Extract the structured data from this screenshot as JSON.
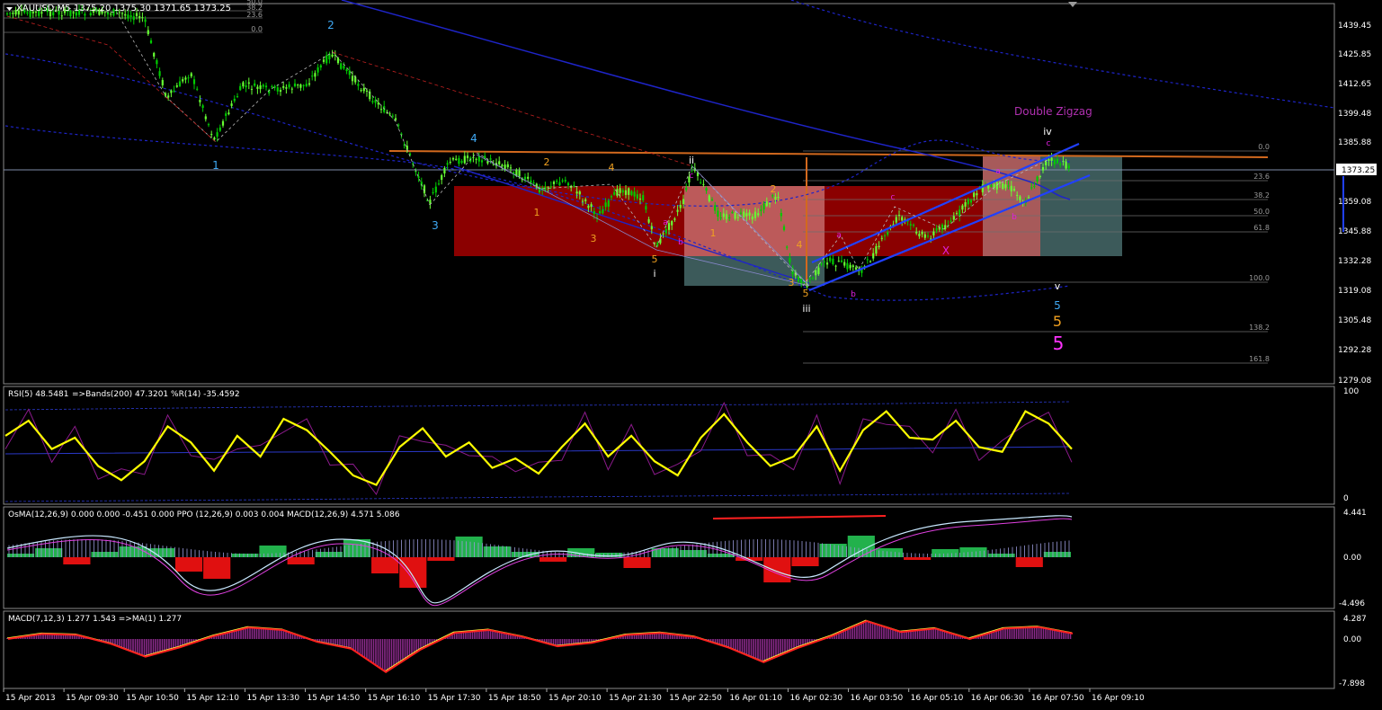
{
  "colors": {
    "background": "#000000",
    "bull_candle": "#66FF33",
    "bear_candle": "#00CC00",
    "ma_blue": "#1E24C8",
    "rsi_line": "#FFFF00",
    "rsi_wpr": "#8B1A8B",
    "osma_pos": "#22B14C",
    "osma_neg": "#E01010",
    "macd_hist": "#8B2A8B",
    "macd_line": "#FF2020",
    "price_line": "#7E8CA8",
    "orange_line": "#D2691E",
    "fib_text": "#9A9A9A",
    "axis_text": "#FFFFFF"
  },
  "header": {
    "symbol": "XAUUSD,M5",
    "ohlc": "1375.20 1375.30 1371.65 1373.25"
  },
  "price_axis": {
    "ticks": [
      "1439.45",
      "1425.85",
      "1412.65",
      "1399.48",
      "1385.88",
      "1373.25",
      "1359.08",
      "1345.88",
      "1332.28",
      "1319.08",
      "1305.48",
      "1292.28",
      "1279.08"
    ],
    "current": "1373.25"
  },
  "fib_top": [
    "50.0",
    "38.2",
    "23.6",
    "0.0"
  ],
  "fib_right": [
    "0.0",
    "23.6",
    "38.2",
    "50.0",
    "61.8",
    "100.0",
    "138.2",
    "161.8"
  ],
  "wave_labels": {
    "cyan": [
      "1",
      "2",
      "3",
      "4",
      "5"
    ],
    "orange": [
      "1",
      "2",
      "3",
      "4",
      "5",
      "1",
      "2",
      "3",
      "4",
      "5",
      "5"
    ],
    "roman": [
      "i",
      "ii",
      "iii",
      "iv",
      "v"
    ],
    "magenta": [
      "a",
      "b",
      "c",
      "a",
      "b",
      "c",
      "a",
      "b",
      "c",
      "X",
      "5"
    ],
    "pattern": "Double Zigzag"
  },
  "rsi_panel": {
    "title": "RSI(5) 48.5481",
    "extra": "=>Bands(200) 47.3201  %R(14) -35.4592",
    "ticks": [
      "100",
      "0"
    ]
  },
  "osma_panel": {
    "title": "OsMA(12,26,9) 0.000 0.000 -0.451 0.000  PPO (12,26,9) 0.003 0.004  MACD(12,26,9) 4.571 5.086",
    "ticks": [
      "4.441",
      "0.00",
      "-4.496"
    ]
  },
  "macd_panel": {
    "title": "MACD(7,12,3) 1.277 1.543  =>MA(1) 1.277",
    "ticks": [
      "4.287",
      "0.00",
      "-7.898"
    ]
  },
  "time_axis": [
    "15 Apr 2013",
    "15 Apr 09:30",
    "15 Apr 10:50",
    "15 Apr 12:10",
    "15 Apr 13:30",
    "15 Apr 14:50",
    "15 Apr 16:10",
    "15 Apr 17:30",
    "15 Apr 18:50",
    "15 Apr 20:10",
    "15 Apr 21:30",
    "15 Apr 22:50",
    "16 Apr 01:10",
    "16 Apr 02:30",
    "16 Apr 03:50",
    "16 Apr 05:10",
    "16 Apr 06:30",
    "16 Apr 07:50",
    "16 Apr 09:10"
  ],
  "chart_data": [
    {
      "type": "candlestick",
      "title": "XAUUSD,M5",
      "ylim": [
        1279.08,
        1445
      ],
      "key_points": [
        {
          "x": "15 Apr 09:10",
          "y": 1443
        },
        {
          "x": "15 Apr 12:10",
          "y": 1386
        },
        {
          "x": "15 Apr 14:50",
          "y": 1427
        },
        {
          "x": "15 Apr 17:30",
          "y": 1353
        },
        {
          "x": "15 Apr 18:50",
          "y": 1377
        },
        {
          "x": "15 Apr 22:50",
          "y": 1338
        },
        {
          "x": "16 Apr 01:10",
          "y": 1367
        },
        {
          "x": "16 Apr 02:30",
          "y": 1321
        },
        {
          "x": "16 Apr 05:10",
          "y": 1356
        },
        {
          "x": "16 Apr 07:50",
          "y": 1366
        },
        {
          "x": "16 Apr 09:10",
          "y": 1376
        }
      ],
      "last": 1373.25
    },
    {
      "type": "line",
      "title": "RSI(5) 48.5481",
      "ylim": [
        0,
        100
      ],
      "values": [
        62,
        78,
        48,
        60,
        30,
        15,
        35,
        72,
        55,
        25,
        62,
        40,
        80,
        68,
        45,
        20,
        10,
        50,
        70,
        40,
        55,
        28,
        38,
        22,
        50,
        75,
        40,
        62,
        35,
        20,
        60,
        85,
        55,
        30,
        40,
        72,
        25,
        68,
        88,
        60,
        58,
        78,
        50,
        45,
        88,
        75,
        48
      ]
    },
    {
      "type": "bar",
      "title": "OsMA(12,26,9)",
      "ylim": [
        -4.496,
        4.441
      ],
      "values": [
        0.4,
        1.0,
        -0.8,
        0.6,
        1.2,
        1.0,
        -1.6,
        -2.4,
        0.4,
        1.3,
        -0.8,
        0.6,
        2.0,
        -1.8,
        -3.4,
        -0.4,
        2.3,
        1.2,
        0.6,
        -0.5,
        1.0,
        0.5,
        -1.2,
        1.0,
        0.8,
        0.4,
        -0.4,
        -2.8,
        -1.0,
        1.5,
        2.4,
        1.0,
        -0.3,
        0.9,
        1.1,
        0.4,
        -1.1,
        0.6
      ]
    },
    {
      "type": "line",
      "title": "MACD(7,12,3)",
      "ylim": [
        -7.898,
        4.287
      ],
      "values": [
        0.2,
        1.2,
        1.0,
        -0.8,
        -3.4,
        -1.5,
        0.8,
        2.5,
        2.0,
        -0.4,
        -1.8,
        -6.5,
        -2.0,
        1.4,
        2.0,
        0.6,
        -1.3,
        -0.6,
        1.0,
        1.4,
        0.6,
        -1.6,
        -4.5,
        -1.6,
        0.8,
        3.8,
        1.6,
        2.3,
        0.2,
        2.3,
        2.6,
        1.3
      ]
    }
  ]
}
